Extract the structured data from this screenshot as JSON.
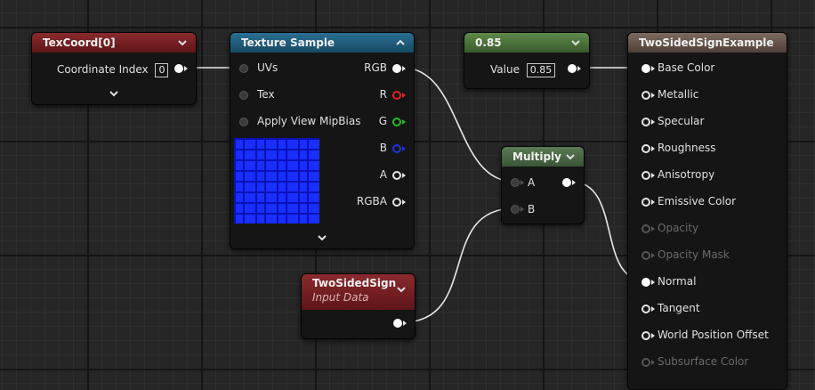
{
  "nodes": {
    "texcoord": {
      "title": "TexCoord[0]",
      "header_color": "#7a1e22",
      "field_label": "Coordinate Index",
      "field_value": "0"
    },
    "texture_sample": {
      "title": "Texture Sample",
      "header_color": "#1f5a78",
      "inputs": [
        "UVs",
        "Tex",
        "Apply View MipBias"
      ],
      "outputs": [
        "RGB",
        "R",
        "G",
        "B",
        "A",
        "RGBA"
      ]
    },
    "constant": {
      "title": "0.85",
      "header_color": "#4a6e3a",
      "field_label": "Value",
      "field_value": "0.85"
    },
    "multiply": {
      "title": "Multiply",
      "header_color": "#4f6b4a",
      "inputs": [
        "A",
        "B"
      ]
    },
    "twosided": {
      "title": "TwoSidedSign",
      "subtitle": "Input Data",
      "header_color": "#7a1e22"
    },
    "material": {
      "title": "TwoSidedSignExample",
      "header_color": "#6b5a50",
      "pins": [
        {
          "label": "Base Color",
          "enabled": true,
          "connected": true
        },
        {
          "label": "Metallic",
          "enabled": true,
          "connected": false
        },
        {
          "label": "Specular",
          "enabled": true,
          "connected": false
        },
        {
          "label": "Roughness",
          "enabled": true,
          "connected": false
        },
        {
          "label": "Anisotropy",
          "enabled": true,
          "connected": false
        },
        {
          "label": "Emissive Color",
          "enabled": true,
          "connected": false
        },
        {
          "label": "Opacity",
          "enabled": false,
          "connected": false
        },
        {
          "label": "Opacity Mask",
          "enabled": false,
          "connected": false
        },
        {
          "label": "Normal",
          "enabled": true,
          "connected": true
        },
        {
          "label": "Tangent",
          "enabled": true,
          "connected": false
        },
        {
          "label": "World Position Offset",
          "enabled": true,
          "connected": false
        },
        {
          "label": "Subsurface Color",
          "enabled": false,
          "connected": false
        }
      ]
    }
  },
  "colors": {
    "pin_r": "#e02020",
    "pin_g": "#20c020",
    "pin_b": "#2030e0",
    "wire": "#e8e8e8"
  }
}
